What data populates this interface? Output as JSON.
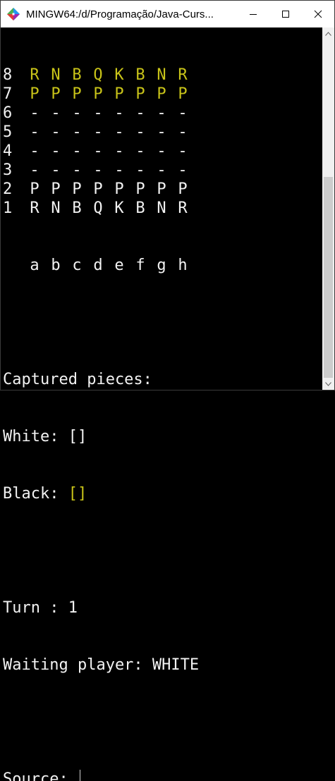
{
  "window": {
    "title": "MINGW64:/d/Programação/Java-Curs...",
    "icon": "mingw-terminal-icon",
    "controls": {
      "minimize": "minimize-icon",
      "maximize": "maximize-icon",
      "close": "close-icon"
    }
  },
  "colors": {
    "background": "#000000",
    "text": "#f2f2f2",
    "black_pieces": "#c9c419"
  },
  "board": {
    "rows": [
      {
        "rank": "8",
        "cells": [
          {
            "p": "R",
            "side": "black"
          },
          {
            "p": "N",
            "side": "black"
          },
          {
            "p": "B",
            "side": "black"
          },
          {
            "p": "Q",
            "side": "black"
          },
          {
            "p": "K",
            "side": "black"
          },
          {
            "p": "B",
            "side": "black"
          },
          {
            "p": "N",
            "side": "black"
          },
          {
            "p": "R",
            "side": "black"
          }
        ]
      },
      {
        "rank": "7",
        "cells": [
          {
            "p": "P",
            "side": "black"
          },
          {
            "p": "P",
            "side": "black"
          },
          {
            "p": "P",
            "side": "black"
          },
          {
            "p": "P",
            "side": "black"
          },
          {
            "p": "P",
            "side": "black"
          },
          {
            "p": "P",
            "side": "black"
          },
          {
            "p": "P",
            "side": "black"
          },
          {
            "p": "P",
            "side": "black"
          }
        ]
      },
      {
        "rank": "6",
        "cells": [
          {
            "p": "-",
            "side": "empty"
          },
          {
            "p": "-",
            "side": "empty"
          },
          {
            "p": "-",
            "side": "empty"
          },
          {
            "p": "-",
            "side": "empty"
          },
          {
            "p": "-",
            "side": "empty"
          },
          {
            "p": "-",
            "side": "empty"
          },
          {
            "p": "-",
            "side": "empty"
          },
          {
            "p": "-",
            "side": "empty"
          }
        ]
      },
      {
        "rank": "5",
        "cells": [
          {
            "p": "-",
            "side": "empty"
          },
          {
            "p": "-",
            "side": "empty"
          },
          {
            "p": "-",
            "side": "empty"
          },
          {
            "p": "-",
            "side": "empty"
          },
          {
            "p": "-",
            "side": "empty"
          },
          {
            "p": "-",
            "side": "empty"
          },
          {
            "p": "-",
            "side": "empty"
          },
          {
            "p": "-",
            "side": "empty"
          }
        ]
      },
      {
        "rank": "4",
        "cells": [
          {
            "p": "-",
            "side": "empty"
          },
          {
            "p": "-",
            "side": "empty"
          },
          {
            "p": "-",
            "side": "empty"
          },
          {
            "p": "-",
            "side": "empty"
          },
          {
            "p": "-",
            "side": "empty"
          },
          {
            "p": "-",
            "side": "empty"
          },
          {
            "p": "-",
            "side": "empty"
          },
          {
            "p": "-",
            "side": "empty"
          }
        ]
      },
      {
        "rank": "3",
        "cells": [
          {
            "p": "-",
            "side": "empty"
          },
          {
            "p": "-",
            "side": "empty"
          },
          {
            "p": "-",
            "side": "empty"
          },
          {
            "p": "-",
            "side": "empty"
          },
          {
            "p": "-",
            "side": "empty"
          },
          {
            "p": "-",
            "side": "empty"
          },
          {
            "p": "-",
            "side": "empty"
          },
          {
            "p": "-",
            "side": "empty"
          }
        ]
      },
      {
        "rank": "2",
        "cells": [
          {
            "p": "P",
            "side": "white"
          },
          {
            "p": "P",
            "side": "white"
          },
          {
            "p": "P",
            "side": "white"
          },
          {
            "p": "P",
            "side": "white"
          },
          {
            "p": "P",
            "side": "white"
          },
          {
            "p": "P",
            "side": "white"
          },
          {
            "p": "P",
            "side": "white"
          },
          {
            "p": "P",
            "side": "white"
          }
        ]
      },
      {
        "rank": "1",
        "cells": [
          {
            "p": "R",
            "side": "white"
          },
          {
            "p": "N",
            "side": "white"
          },
          {
            "p": "B",
            "side": "white"
          },
          {
            "p": "Q",
            "side": "white"
          },
          {
            "p": "K",
            "side": "white"
          },
          {
            "p": "B",
            "side": "white"
          },
          {
            "p": "N",
            "side": "white"
          },
          {
            "p": "R",
            "side": "white"
          }
        ]
      }
    ],
    "files": [
      "a",
      "b",
      "c",
      "d",
      "e",
      "f",
      "g",
      "h"
    ]
  },
  "captured": {
    "heading": "Captured pieces:",
    "white_label": "White: ",
    "white_value": "[]",
    "black_label": "Black: ",
    "black_value": "[]"
  },
  "turn": {
    "turn_text": "Turn : 1",
    "waiting_text": "Waiting player: WHITE"
  },
  "prompt": {
    "label": "Source: ",
    "value": ""
  }
}
